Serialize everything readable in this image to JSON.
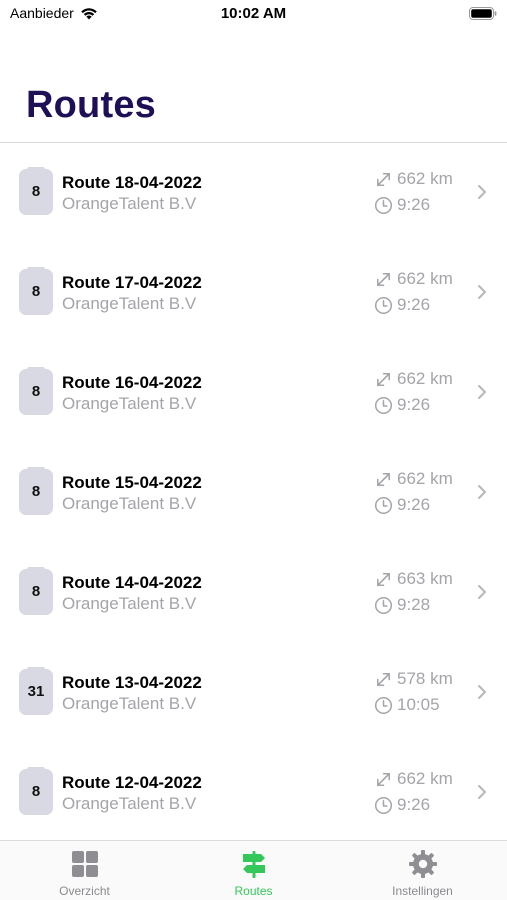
{
  "status_bar": {
    "carrier": "Aanbieder",
    "time": "10:02 AM"
  },
  "header": {
    "title": "Routes"
  },
  "routes": [
    {
      "badge": "8",
      "title": "Route 18-04-2022",
      "company": "OrangeTalent B.V",
      "distance": "662 km",
      "duration": "9:26"
    },
    {
      "badge": "8",
      "title": "Route 17-04-2022",
      "company": "OrangeTalent B.V",
      "distance": "662 km",
      "duration": "9:26"
    },
    {
      "badge": "8",
      "title": "Route 16-04-2022",
      "company": "OrangeTalent B.V",
      "distance": "662 km",
      "duration": "9:26"
    },
    {
      "badge": "8",
      "title": "Route 15-04-2022",
      "company": "OrangeTalent B.V",
      "distance": "662 km",
      "duration": "9:26"
    },
    {
      "badge": "8",
      "title": "Route 14-04-2022",
      "company": "OrangeTalent B.V",
      "distance": "663 km",
      "duration": "9:28"
    },
    {
      "badge": "31",
      "title": "Route 13-04-2022",
      "company": "OrangeTalent B.V",
      "distance": "578 km",
      "duration": "10:05"
    },
    {
      "badge": "8",
      "title": "Route 12-04-2022",
      "company": "OrangeTalent B.V",
      "distance": "662 km",
      "duration": "9:26"
    }
  ],
  "tab_bar": {
    "tabs": [
      {
        "label": "Overzicht",
        "icon": "grid-icon",
        "active": false
      },
      {
        "label": "Routes",
        "icon": "signpost-icon",
        "active": true
      },
      {
        "label": "Instellingen",
        "icon": "gear-icon",
        "active": false
      }
    ]
  },
  "colors": {
    "title": "#1f0f56",
    "secondary_text": "#a4a4aa",
    "active_tab": "#34c759",
    "badge_bg": "#d9d9e3"
  }
}
